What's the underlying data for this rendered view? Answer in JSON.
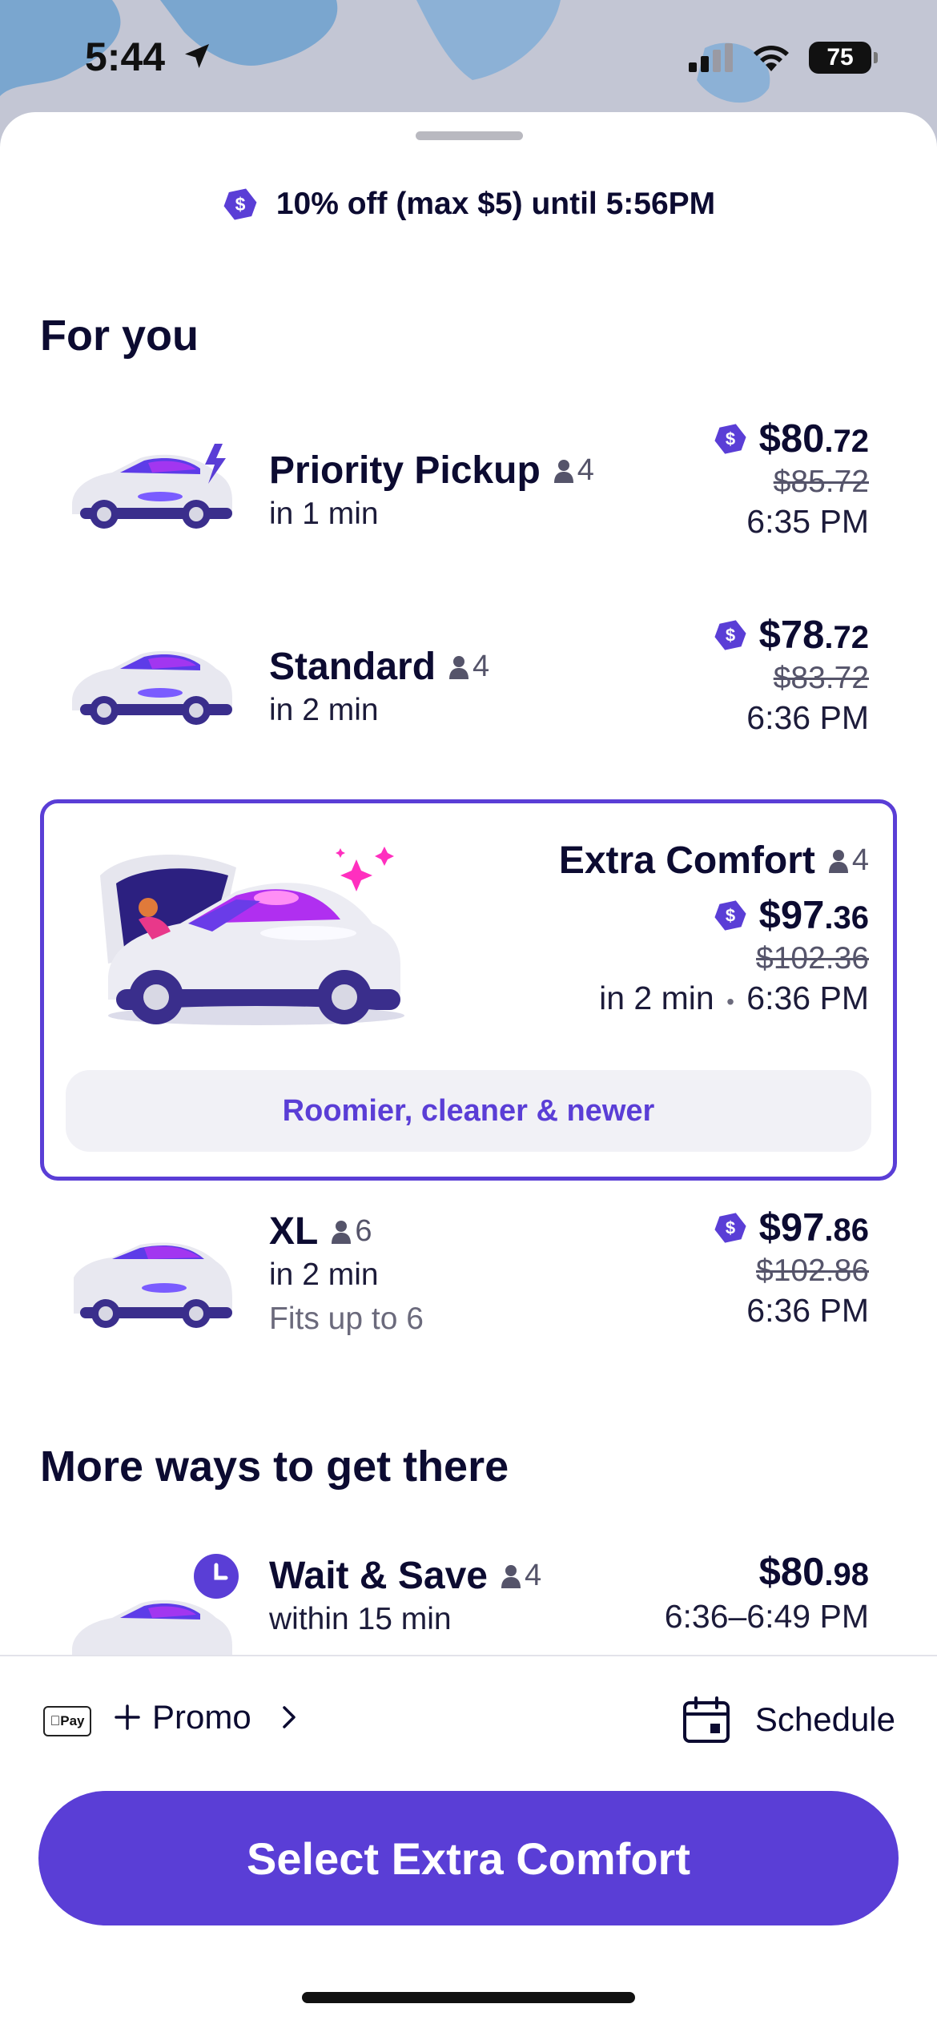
{
  "status_bar": {
    "time": "5:44",
    "battery": "75"
  },
  "promo_banner": {
    "text": "10% off (max $5) until 5:56PM"
  },
  "sections": {
    "for_you": "For you",
    "more_ways": "More ways to get there"
  },
  "rides": {
    "priority": {
      "name": "Priority Pickup",
      "seats": "4",
      "wait": "in 1 min",
      "price_dollars": "$80",
      "price_cents": ".72",
      "old_price": "$85.72",
      "arrival": "6:35 PM"
    },
    "standard": {
      "name": "Standard",
      "seats": "4",
      "wait": "in 2 min",
      "price_dollars": "$78",
      "price_cents": ".72",
      "old_price": "$83.72",
      "arrival": "6:36 PM"
    },
    "extra_comfort": {
      "name": "Extra Comfort",
      "seats": "4",
      "price_dollars": "$97",
      "price_cents": ".36",
      "old_price": "$102.36",
      "wait": "in 2 min",
      "separator": "•",
      "arrival": "6:36 PM",
      "feature": "Roomier, cleaner & newer"
    },
    "xl": {
      "name": "XL",
      "seats": "6",
      "wait": "in 2 min",
      "note": "Fits up to 6",
      "price_dollars": "$97",
      "price_cents": ".86",
      "old_price": "$102.86",
      "arrival": "6:36 PM"
    },
    "wait_save": {
      "name": "Wait & Save",
      "seats": "4",
      "wait": "within 15 min",
      "price_dollars": "$80",
      "price_cents": ".98",
      "arrival": "6:36–6:49 PM"
    }
  },
  "bottom": {
    "applepay": "Pay",
    "promo": "Promo",
    "schedule": "Schedule",
    "select_button": "Select Extra Comfort"
  },
  "colors": {
    "accent": "#5a3ed6",
    "text": "#0c0b31",
    "muted": "#55546a"
  }
}
